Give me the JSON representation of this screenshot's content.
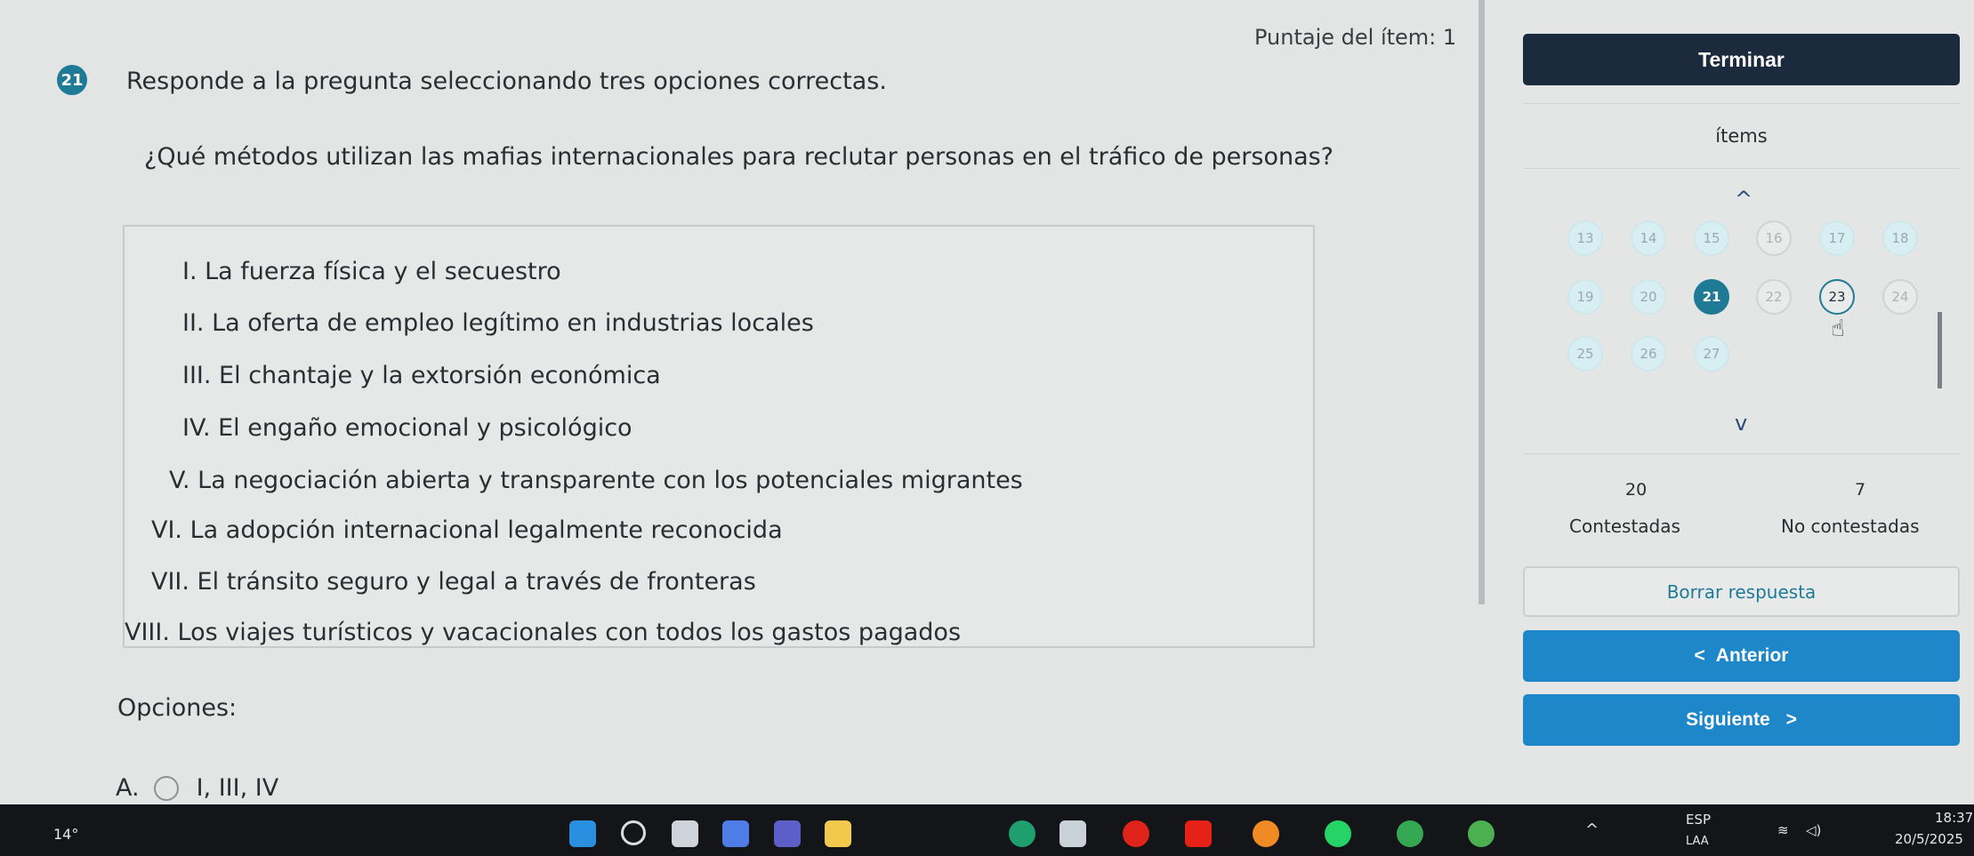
{
  "header": {
    "score": "Puntaje del ítem: 1"
  },
  "question": {
    "number": "21",
    "instruction": "Responde a la pregunta seleccionando tres opciones correctas.",
    "text": "¿Qué métodos utilizan las mafias internacionales para reclutar personas en el tráfico de personas?",
    "statements": [
      "I. La fuerza física y el secuestro",
      "II. La oferta de empleo legítimo en industrias locales",
      "III. El chantaje y la extorsión económica",
      "IV. El engaño emocional y psicológico",
      "V. La negociación abierta y transparente con los potenciales migrantes",
      "VI. La adopción internacional legalmente reconocida",
      "VII. El tránsito seguro y legal a través de fronteras",
      "VIII. Los viajes turísticos y vacacionales con todos los gastos pagados"
    ],
    "options_label": "Opciones:",
    "options": [
      {
        "letter": "A.",
        "text": "I, III, IV"
      }
    ]
  },
  "panel": {
    "terminar_label": "Terminar",
    "items_label": "ítems",
    "chevron_up": "^",
    "chevron_down": "v",
    "items": [
      "13",
      "14",
      "15",
      "16",
      "17",
      "18",
      "19",
      "20",
      "21",
      "22",
      "23",
      "24",
      "25",
      "26",
      "27"
    ],
    "current_item": "21",
    "stats": {
      "answered_count": "20",
      "answered_label": "Contestadas",
      "unanswered_count": "7",
      "unanswered_label": "No contestadas"
    },
    "borrar_label": "Borrar respuesta",
    "anterior_label": "Anterior",
    "siguiente_label": "Siguiente",
    "anterior_chevron": "<",
    "siguiente_chevron": ">"
  },
  "taskbar": {
    "weather": "14°",
    "language": "ESP",
    "language_sub": "LAA",
    "time": "18:37",
    "date": "20/5/2025"
  },
  "colors": {
    "accent": "#1f7a95",
    "primary_button": "#1d87c9",
    "dark_button": "#1b2a3d"
  }
}
